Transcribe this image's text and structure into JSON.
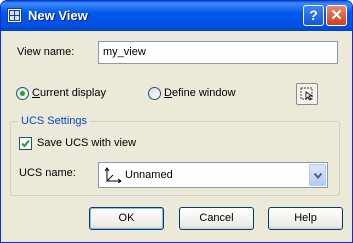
{
  "window": {
    "title": "New View",
    "help_label": "?",
    "close_label": "✕"
  },
  "view_name": {
    "label": "View name:",
    "value": "my_view"
  },
  "options": {
    "current_display_label": "Current display",
    "define_window_label": "Define window",
    "selected": "current_display"
  },
  "ucs_settings": {
    "group_title": "UCS Settings",
    "save_ucs_label": "Save UCS with view",
    "save_ucs_checked": true,
    "ucs_name_label": "UCS name:",
    "ucs_name_value": "Unnamed"
  },
  "buttons": {
    "ok": "OK",
    "cancel": "Cancel",
    "help": "Help"
  },
  "colors": {
    "title_bar": "#0058ee",
    "dialog_bg": "#ece9d8",
    "group_title": "#0046d5"
  },
  "icons": {
    "title": "view-icon",
    "pick": "pick-window-icon",
    "ucs": "ucs-axis-icon"
  }
}
